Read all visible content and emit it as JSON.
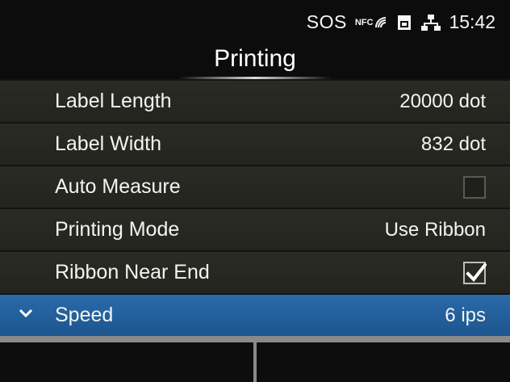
{
  "status_bar": {
    "sos": "SOS",
    "nfc": "NFC",
    "icons": [
      "nfc-signal-icon",
      "sd-card-icon",
      "network-icon"
    ],
    "time": "15:42"
  },
  "title": "Printing",
  "items": [
    {
      "label": "Label Length",
      "value": "20000 dot"
    },
    {
      "label": "Label Width",
      "value": "832 dot"
    },
    {
      "label": "Auto Measure",
      "checkbox": false
    },
    {
      "label": "Printing Mode",
      "value": "Use Ribbon"
    },
    {
      "label": "Ribbon Near End",
      "checkbox": true
    },
    {
      "label": "Speed",
      "value": "6 ips",
      "selected": true
    }
  ],
  "softkeys": [
    "",
    ""
  ],
  "colors": {
    "selected": "#2a6aa8",
    "row": "#2b2b25",
    "softkey_border": "#8a8a8a"
  }
}
